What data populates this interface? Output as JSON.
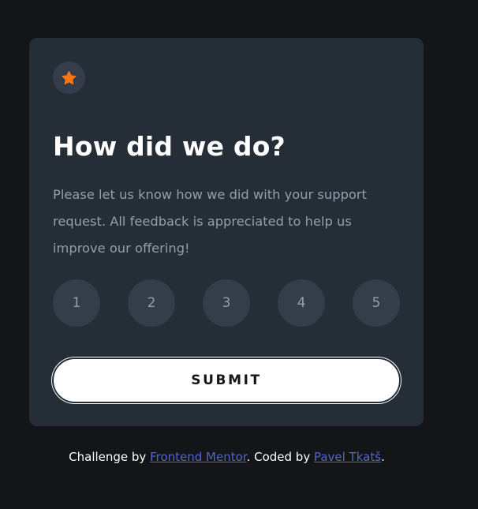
{
  "card": {
    "icon": "star-icon",
    "title": "How did we do?",
    "description": "Please let us know how we did with your support request. All feedback is appreciated to help us improve our offering!",
    "ratings": [
      "1",
      "2",
      "3",
      "4",
      "5"
    ],
    "submit_label": "SUBMIT"
  },
  "attribution": {
    "prefix": "Challenge by ",
    "link1": "Frontend Mentor",
    "middle": ". Coded by ",
    "link2": "Pavel Tkatš",
    "suffix": "."
  },
  "colors": {
    "background": "#131518",
    "card": "#252d37",
    "accent": "#fc7614",
    "text_muted": "#959eac",
    "link": "#5465c9"
  }
}
